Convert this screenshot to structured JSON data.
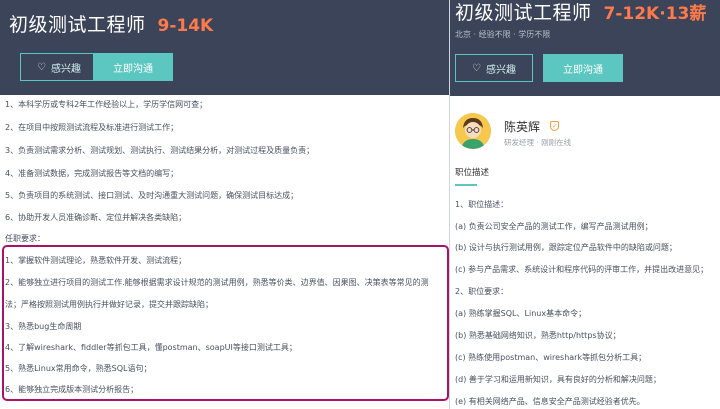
{
  "left": {
    "title": "初级测试工程师",
    "salary": "9-14K",
    "btn_interest": "感兴趣",
    "btn_chat": "立即沟通",
    "lines": [
      "1、本科学历或专科2年工作经验以上，学历学信网可查；",
      "2、在项目中按照测试流程及标准进行测试工作；",
      "3、负责测试需求分析、测试规划、测试执行、测试结果分析，对测试过程及质量负责；",
      "4、准备测试数据，完成测试报告等文档的编写；",
      "5、负责项目的系统测试、接口测试、及时沟通重大测试问题，确保测试目标达成；",
      "6、协助开发人员准确诊断、定位并解决各类缺陷；",
      "任职要求：",
      "1、掌握软件测试理论，熟悉软件开发、测试流程；",
      "2、能够独立进行项目的测试工作.能够根据需求设计规范的测试用例，熟悉等价类、边界值、因果图、决策表等常见的测",
      "法；严格按照测试用例执行并做好记录，提交并跟踪缺陷；",
      "3、熟悉bug生命周期",
      "4、了解wireshark、fiddler等抓包工具，懂postman、soapUI等接口测试工具；",
      "5、熟悉Linux常用命令，熟悉SQL语句；",
      "6、能够独立完成版本测试分析报告；"
    ]
  },
  "right": {
    "title": "初级测试工程师",
    "salary": "7-12K·13薪",
    "meta": "北京 · 经验不限 · 学历不限",
    "btn_interest": "感兴趣",
    "btn_chat": "立即沟通",
    "recruiter_name": "陈英辉",
    "recruiter_role": "研发经理 · 刚刚在线",
    "section_title": "职位描述",
    "lines": [
      "1、职位描述：",
      "(a) 负责公司安全产品的测试工作，编写产品测试用例；",
      "(b) 设计与执行测试用例，跟踪定位产品软件中的缺陷或问题；",
      "(c) 参与产品需求、系统设计和程序代码的评审工作，并提出改进意见；",
      "2、职位要求：",
      "(a) 熟练掌握SQL、Linux基本命令；",
      "(b) 熟悉基础网络知识，熟悉http/https协议；",
      "(c) 熟练使用postman、wireshark等抓包分析工具；",
      "(d) 善于学习和运用新知识，具有良好的分析和解决问题；",
      "(e) 有相关网络产品、信息安全产品测试经验者优先。"
    ]
  },
  "colors": {
    "header_bg": "#3b4458",
    "salary": "#ff7a4a",
    "accent": "#5cc7c0",
    "highlight": "#a8136a"
  },
  "icons": [
    "heart-icon",
    "avatar-icon",
    "verified-badge-icon"
  ]
}
